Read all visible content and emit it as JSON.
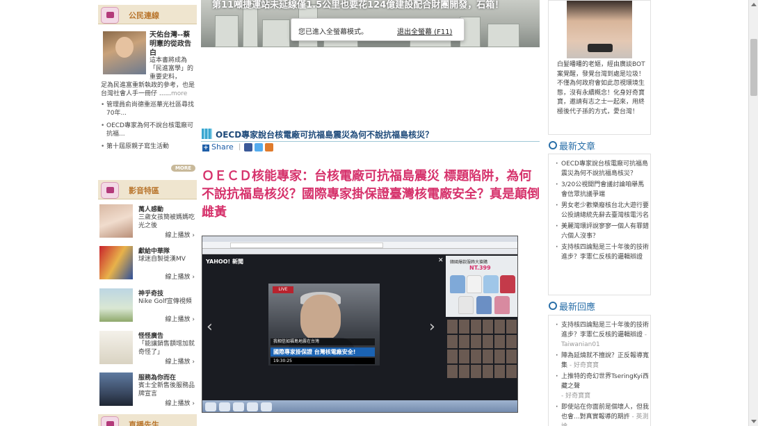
{
  "fullscreen_notice": {
    "message": "您已進入全螢幕模式。",
    "exit_label": "退出全螢幕 (F11)"
  },
  "left": {
    "citizen": {
      "title": "公民連線",
      "lead_title": "天佑台灣--蔡明憲的從政告白",
      "lead_text": "這本書將成為「民進富學」的重要史料，",
      "lead_text2": "足為民進富重新執政的參考，也是台灣社會人手一冊仔 ......",
      "lead_more": "more",
      "items": [
        "管理員俞尚德重巡華光社區尋找70年...",
        "OECD專家為何不說台核電廠可抗福...",
        "第十屆原親子寫生活動"
      ],
      "more_label": "MORE"
    },
    "av": {
      "title": "影音特區",
      "items": [
        {
          "title": "萬人感動",
          "desc": "三歲女孩簡被媽媽吃光之後",
          "play": "線上播放"
        },
        {
          "title": "獻給中華隊",
          "desc": "球迷自製徙漢MV",
          "play": "線上播放"
        },
        {
          "title": "神乎奇技",
          "desc": "Nike Golf宣傳視頻",
          "play": "線上播放"
        },
        {
          "title": "怪怪廣告",
          "desc": "「能讓銷售額增加就奇怪了」",
          "play": "線上播放"
        },
        {
          "title": "服務為你而在",
          "desc": "賓士全新售後服務品牌宣言",
          "play": "線上播放"
        }
      ],
      "next_section": "直播先生"
    }
  },
  "center": {
    "banner_caption": "第11噸捷運站未延線僅1.5公里也要花124億建設配合財團開發，石箱！",
    "post_title": "OECD專家說台核電廠可抗福島震災為何不說抗福島核災？",
    "share_label": "Share",
    "article_heading": "ＯＥＣＤ核能專家：台核電廠可抗福島震災 標題陷阱，為何不說抗福島核災？國際專家掛保證臺灣核電廠安全？真是顛倒雌黃",
    "video": {
      "logo": "YAHOO! 新聞",
      "ad_text": "韓國爆款服飾大搶購",
      "ad_price": "NT.399",
      "caption1": "我相信如福島地震在台灣",
      "caption2": "國際專家掛保證 台灣核電廠安全!",
      "time": "19:30:25"
    }
  },
  "right": {
    "promo_text": "白髮皤皤的老嫗，經由廣談BOT案覺醒，發覺台灣到處是垃圾！ 不僅為何政府會如此忽視環境生態，沒有永續概念！化身好奇寶寶，邀請有志之士一起來，用終極後代子孫的方式，愛台灣！",
    "latest_articles": {
      "title": "最新文章",
      "items": [
        "OECD專家說台核電廠可抗福島震災為何不說抗福島核災？",
        "3/20公視開門會議討論咱舉馬會信眾抗議爭端",
        "男女老少歡樂廢核台北大遊行要公投請總統先辭去臺灣核電污名",
        "美麗灣環評說寥寥一個人有罪錯六個人沒事？",
        "支持核四論點是三十年後的技術進步？李憲仁反核的邏輯辯證"
      ]
    },
    "latest_replies": {
      "title": "最新回應",
      "items": [
        {
          "text": "支持核四論點是三十年後的技術進步？李憲仁反核的邏輯辯證",
          "who": " - Taiwanian01"
        },
        {
          "text": "陣為延燒就不擅說？正反報導寬集",
          "who": " - 好奇寶寶"
        },
        {
          "text": "上推特的奇幻世界TseringKyi西藏之聲",
          "who": " - 好奇寶寶"
        },
        {
          "text": "即使站在你面前是個壞人，但我也會...對真實報導的期許",
          "who": " - 英測論"
        }
      ]
    }
  }
}
